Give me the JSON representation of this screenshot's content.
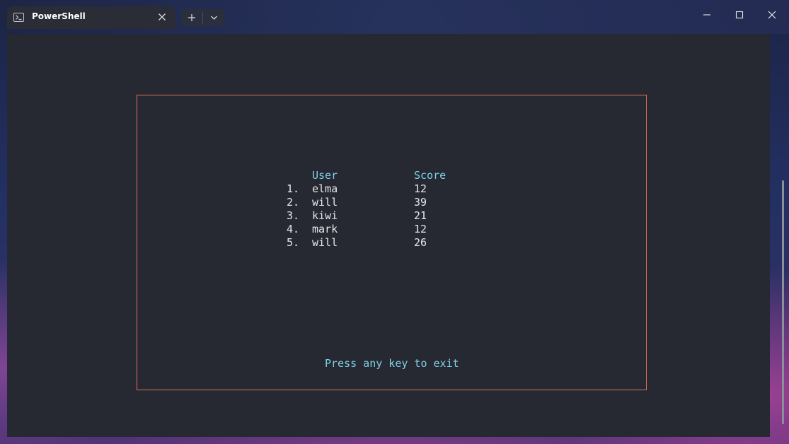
{
  "tab": {
    "title": "PowerShell",
    "icon": "powershell-icon",
    "close_icon": "close-icon"
  },
  "tab_actions": {
    "new_tab_icon": "plus-icon",
    "dropdown_icon": "chevron-down-icon"
  },
  "window_controls": {
    "minimize_icon": "minimize-icon",
    "maximize_icon": "maximize-icon",
    "close_icon": "close-icon"
  },
  "terminal": {
    "background": "#272932",
    "frame_color": "#e06c5a",
    "header_color": "#7fd3e6",
    "table": {
      "headers": {
        "user": "User",
        "score": "Score"
      },
      "rows": [
        {
          "rank": "1.",
          "user": "elma",
          "score": "12"
        },
        {
          "rank": "2.",
          "user": "will",
          "score": "39"
        },
        {
          "rank": "3.",
          "user": "kiwi",
          "score": "21"
        },
        {
          "rank": "4.",
          "user": "mark",
          "score": "12"
        },
        {
          "rank": "5.",
          "user": "will",
          "score": "26"
        }
      ]
    },
    "exit_message": "Press any key to exit"
  }
}
